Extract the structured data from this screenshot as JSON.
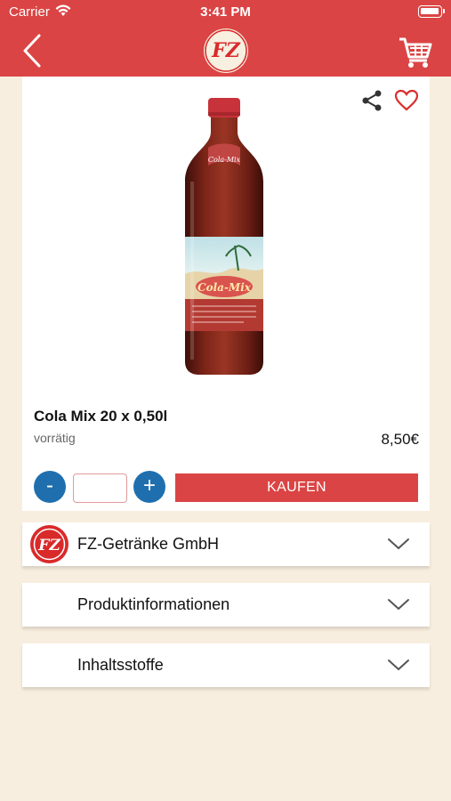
{
  "status_bar": {
    "carrier": "Carrier",
    "time": "3:41 PM"
  },
  "header": {
    "logo_text": "FZ"
  },
  "product": {
    "name": "Cola Mix 20 x 0,50l",
    "stock": "vorrätig",
    "price": "8,50€",
    "label_text": "Cola-Mix"
  },
  "quantity": {
    "minus_label": "-",
    "plus_label": "+",
    "value": ""
  },
  "buy_label": "KAUFEN",
  "accordions": [
    {
      "label": "FZ-Getränke GmbH"
    },
    {
      "label": "Produktinformationen"
    },
    {
      "label": "Inhaltsstoffe"
    }
  ],
  "colors": {
    "brand_red": "#db4444",
    "accent_blue": "#1f6fae",
    "background": "#f8eedf"
  }
}
